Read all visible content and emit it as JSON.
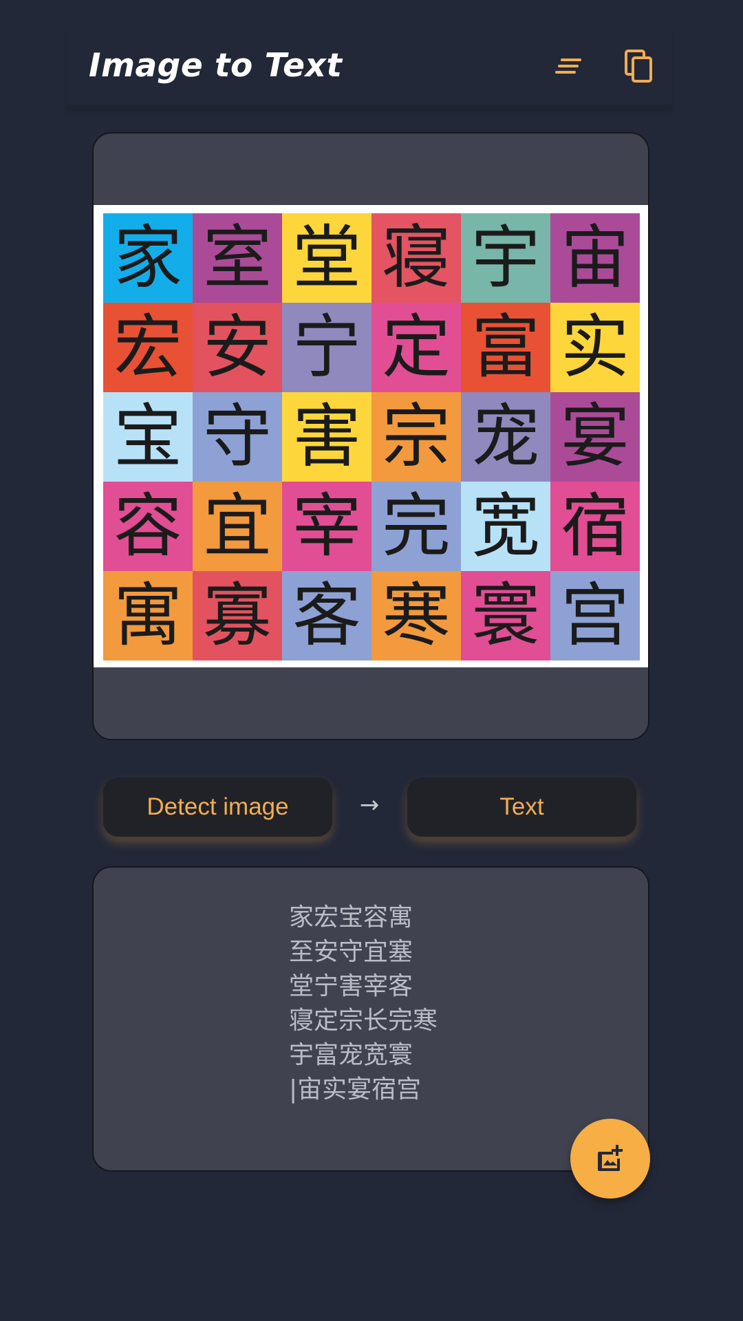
{
  "appbar": {
    "title": "Image to Text",
    "icons": [
      "menu-lines-icon",
      "copy-icon"
    ],
    "accent_color": "#f3ad4f"
  },
  "image_grid": {
    "rows": [
      [
        {
          "ch": "家",
          "color": "#13aee9"
        },
        {
          "ch": "室",
          "color": "#ab4b98"
        },
        {
          "ch": "堂",
          "color": "#fdd63b"
        },
        {
          "ch": "寝",
          "color": "#e45462"
        },
        {
          "ch": "宇",
          "color": "#77b6a8"
        },
        {
          "ch": "宙",
          "color": "#ab4b98"
        }
      ],
      [
        {
          "ch": "宏",
          "color": "#e85134"
        },
        {
          "ch": "安",
          "color": "#e2535f"
        },
        {
          "ch": "宁",
          "color": "#8f89be"
        },
        {
          "ch": "定",
          "color": "#e14e94"
        },
        {
          "ch": "富",
          "color": "#e85134"
        },
        {
          "ch": "实",
          "color": "#fdd63b"
        }
      ],
      [
        {
          "ch": "宝",
          "color": "#b7e1f7"
        },
        {
          "ch": "守",
          "color": "#8ea1d4"
        },
        {
          "ch": "害",
          "color": "#fdd63b"
        },
        {
          "ch": "宗",
          "color": "#f29a3d"
        },
        {
          "ch": "宠",
          "color": "#8f89be"
        },
        {
          "ch": "宴",
          "color": "#ab4b98"
        }
      ],
      [
        {
          "ch": "容",
          "color": "#e14e94"
        },
        {
          "ch": "宜",
          "color": "#f29a3d"
        },
        {
          "ch": "宰",
          "color": "#e14e94"
        },
        {
          "ch": "完",
          "color": "#8ea1d4"
        },
        {
          "ch": "宽",
          "color": "#b7e1f7"
        },
        {
          "ch": "宿",
          "color": "#e14e94"
        }
      ],
      [
        {
          "ch": "寓",
          "color": "#f29a3d"
        },
        {
          "ch": "寡",
          "color": "#e2535f"
        },
        {
          "ch": "客",
          "color": "#8ea1d4"
        },
        {
          "ch": "寒",
          "color": "#f29a3d"
        },
        {
          "ch": "寰",
          "color": "#e14e94"
        },
        {
          "ch": "宫",
          "color": "#8ea1d4"
        }
      ]
    ]
  },
  "actions": {
    "detect_label": "Detect image",
    "arrow": "→",
    "text_label": "Text"
  },
  "result": {
    "lines": [
      "家宏宝容寓",
      "至安守宜塞",
      "堂宁害宰客",
      "寝定宗长完寒",
      "宇富宠宽寰",
      "|宙实宴宿宫"
    ]
  },
  "fab": {
    "icon": "add-image-icon"
  }
}
